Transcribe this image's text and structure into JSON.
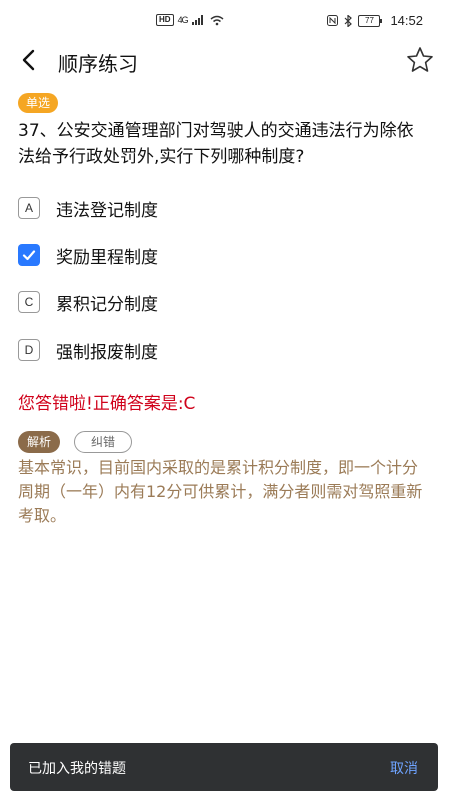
{
  "status_bar": {
    "hd": "HD",
    "network": "4G",
    "battery": "77",
    "time": "14:52"
  },
  "header": {
    "title": "顺序练习"
  },
  "question": {
    "type_badge": "单选",
    "text": "37、公安交通管理部门对驾驶人的交通违法行为除依法给予行政处罚外,实行下列哪种制度?",
    "options": [
      {
        "key": "A",
        "label": "违法登记制度",
        "selected": false
      },
      {
        "key": "B",
        "label": "奖励里程制度",
        "selected": true
      },
      {
        "key": "C",
        "label": "累积记分制度",
        "selected": false
      },
      {
        "key": "D",
        "label": "强制报废制度",
        "selected": false
      }
    ]
  },
  "result": {
    "text": "您答错啦!正确答案是:C"
  },
  "explanation": {
    "tag": "解析",
    "report_button": "纠错",
    "text": "基本常识，目前国内采取的是累计积分制度，即一个计分周期（一年）内有12分可供累计，满分者则需对驾照重新考取。"
  },
  "toast": {
    "message": "已加入我的错题",
    "action": "取消"
  },
  "colors": {
    "badge": "#f5a623",
    "checkbox": "#2979ff",
    "error": "#d0021b",
    "explanation": "#9b7b57"
  }
}
